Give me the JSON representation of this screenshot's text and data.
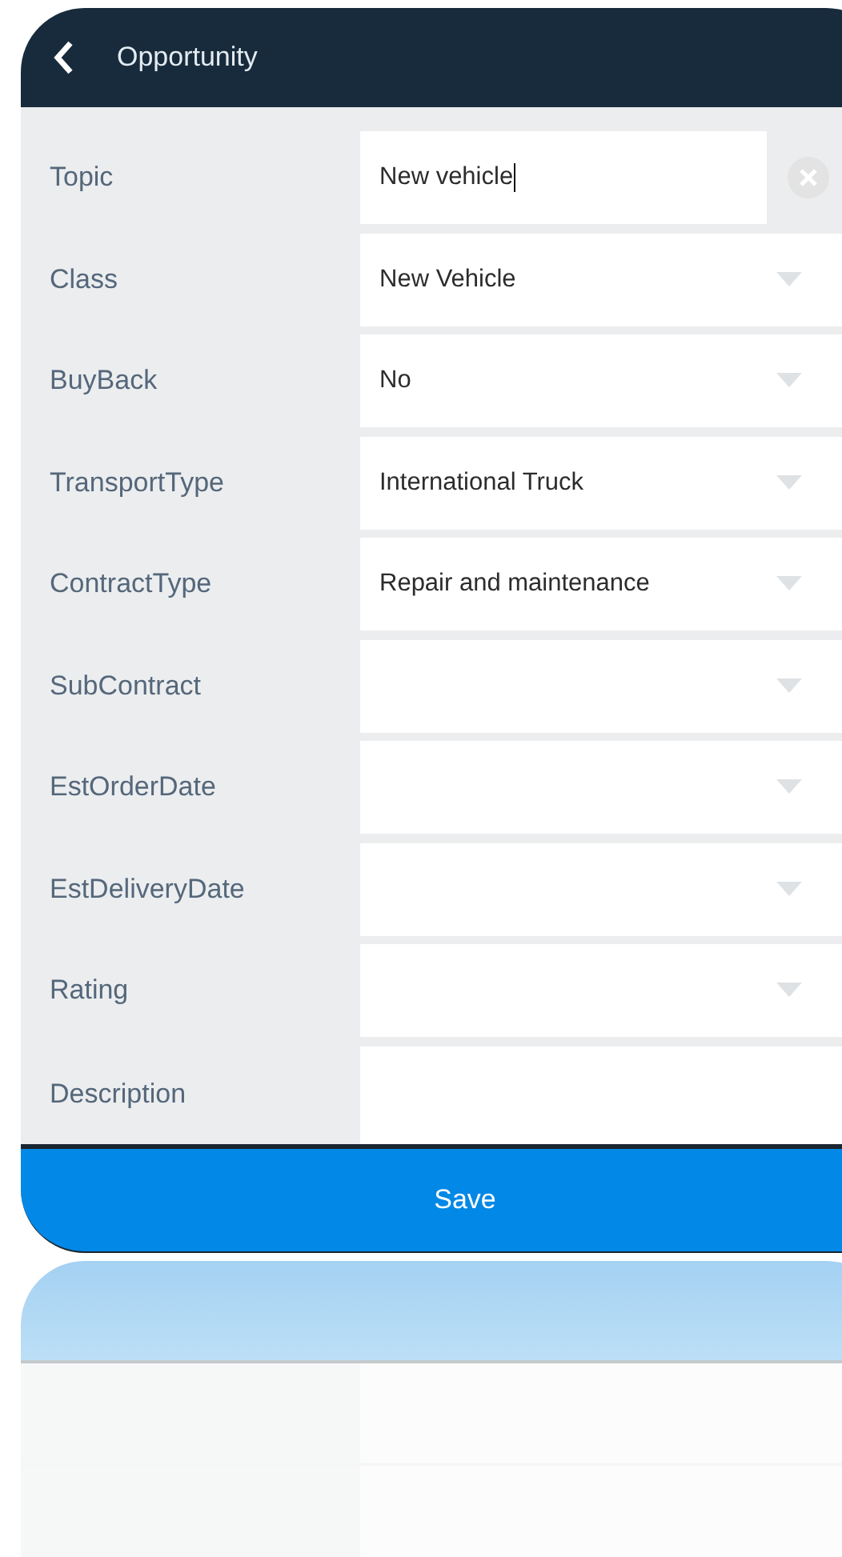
{
  "header": {
    "title": "Opportunity"
  },
  "fields": [
    {
      "label": "Topic",
      "kind": "text",
      "value": "New vehicle",
      "focused": true
    },
    {
      "label": "Class",
      "kind": "select",
      "value": "New Vehicle"
    },
    {
      "label": "BuyBack",
      "kind": "select",
      "value": "No"
    },
    {
      "label": "TransportType",
      "kind": "select",
      "value": "International Truck"
    },
    {
      "label": "ContractType",
      "kind": "select",
      "value": "Repair and maintenance"
    },
    {
      "label": "SubContract",
      "kind": "select"
    },
    {
      "label": "EstOrderDate",
      "kind": "select"
    },
    {
      "label": "EstDeliveryDate",
      "kind": "select"
    },
    {
      "label": "Rating",
      "kind": "select"
    },
    {
      "label": "Description",
      "kind": "textarea"
    }
  ],
  "save_button": {
    "label": "Save"
  }
}
